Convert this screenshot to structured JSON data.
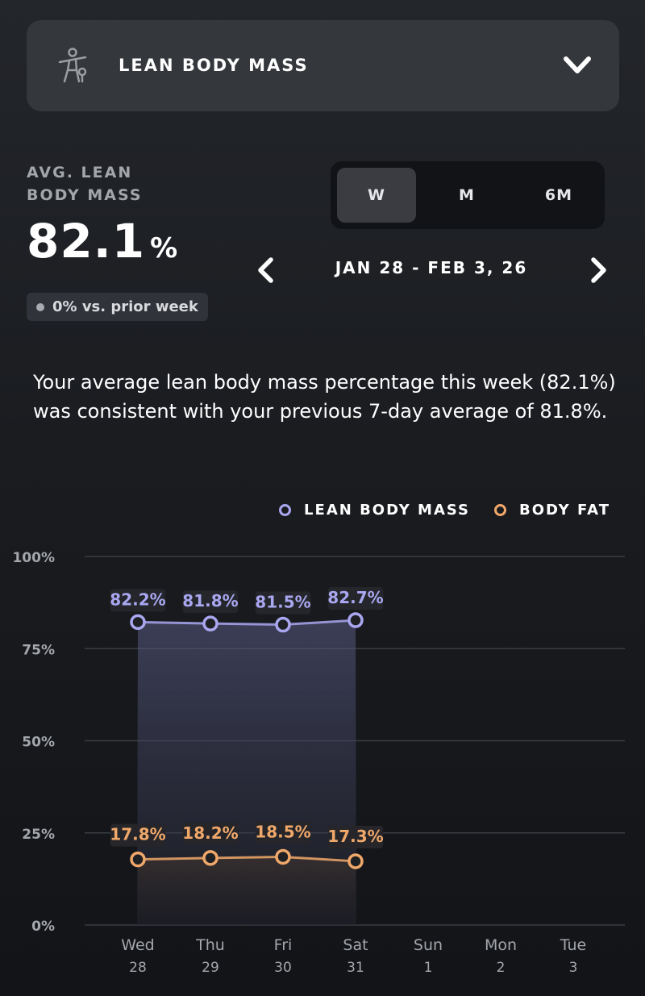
{
  "header": {
    "metric_title": "LEAN BODY MASS",
    "icon": "body-figure-icon",
    "dropdown_icon": "chevron-down-icon"
  },
  "summary_stat": {
    "label": "AVG. LEAN BODY MASS",
    "value": "82.1",
    "unit": "%",
    "change": "0% vs. prior week"
  },
  "range_tabs": [
    {
      "label": "W",
      "active": true
    },
    {
      "label": "M",
      "active": false
    },
    {
      "label": "6M",
      "active": false
    }
  ],
  "date_nav": {
    "range": "JAN 28 - FEB 3, 26",
    "prev_icon": "chevron-left-icon",
    "next_icon": "chevron-right-icon"
  },
  "insight": "Your average lean body mass percentage this week (82.1%) was consistent with your previous 7-day average of 81.8%.",
  "colors": {
    "lean": "#a9a7f0",
    "fat": "#f0a86a",
    "grid": "#3a3d42",
    "axis_text": "#a3a6ab"
  },
  "chart_data": {
    "type": "line",
    "categories": [
      "Wed 28",
      "Thu 29",
      "Fri 30",
      "Sat 31",
      "Sun 1",
      "Mon 2",
      "Tue 3"
    ],
    "x_days": [
      "Wed",
      "Thu",
      "Fri",
      "Sat",
      "Sun",
      "Mon",
      "Tue"
    ],
    "x_dates": [
      "28",
      "29",
      "30",
      "31",
      "1",
      "2",
      "3"
    ],
    "y_ticks": [
      "0%",
      "25%",
      "50%",
      "75%",
      "100%"
    ],
    "ylim": [
      0,
      100
    ],
    "grid": true,
    "legend_position": "top-right",
    "series": [
      {
        "name": "LEAN BODY MASS",
        "values": [
          82.2,
          81.8,
          81.5,
          82.7
        ],
        "labels": [
          "82.2%",
          "81.8%",
          "81.5%",
          "82.7%"
        ]
      },
      {
        "name": "BODY FAT",
        "values": [
          17.8,
          18.2,
          18.5,
          17.3
        ],
        "labels": [
          "17.8%",
          "18.2%",
          "18.5%",
          "17.3%"
        ]
      }
    ]
  }
}
